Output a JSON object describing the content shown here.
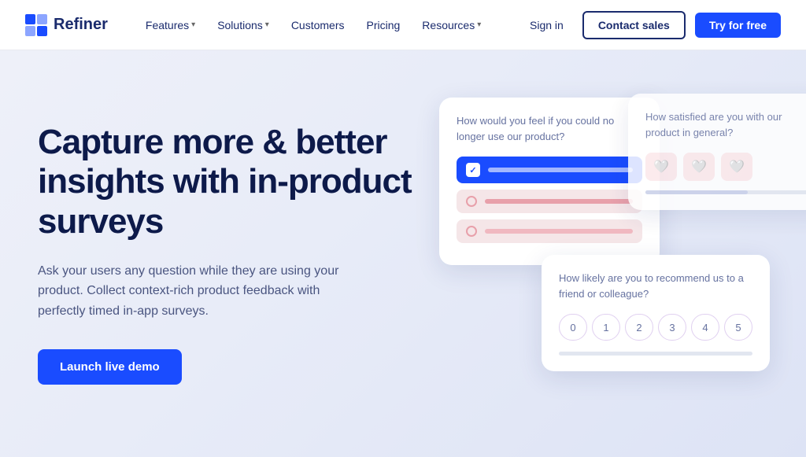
{
  "brand": {
    "name": "Refiner",
    "logo_alt": "Refiner logo"
  },
  "nav": {
    "features_label": "Features",
    "solutions_label": "Solutions",
    "customers_label": "Customers",
    "pricing_label": "Pricing",
    "resources_label": "Resources",
    "signin_label": "Sign in",
    "contact_label": "Contact sales",
    "try_label": "Try for free"
  },
  "hero": {
    "title": "Capture more & better insights with in-product surveys",
    "subtitle": "Ask your users any question while they are using your product. Collect context-rich product feedback with perfectly timed in-app surveys.",
    "cta_label": "Launch live demo"
  },
  "cards": {
    "card1_question": "How would you feel if you could no longer use our product?",
    "card2_question": "How satisfied are you with our product in general?",
    "card3_question": "How likely are you to recommend us to a friend or colleague?",
    "nps_labels": [
      "0",
      "1",
      "2",
      "3",
      "4",
      "5"
    ]
  }
}
